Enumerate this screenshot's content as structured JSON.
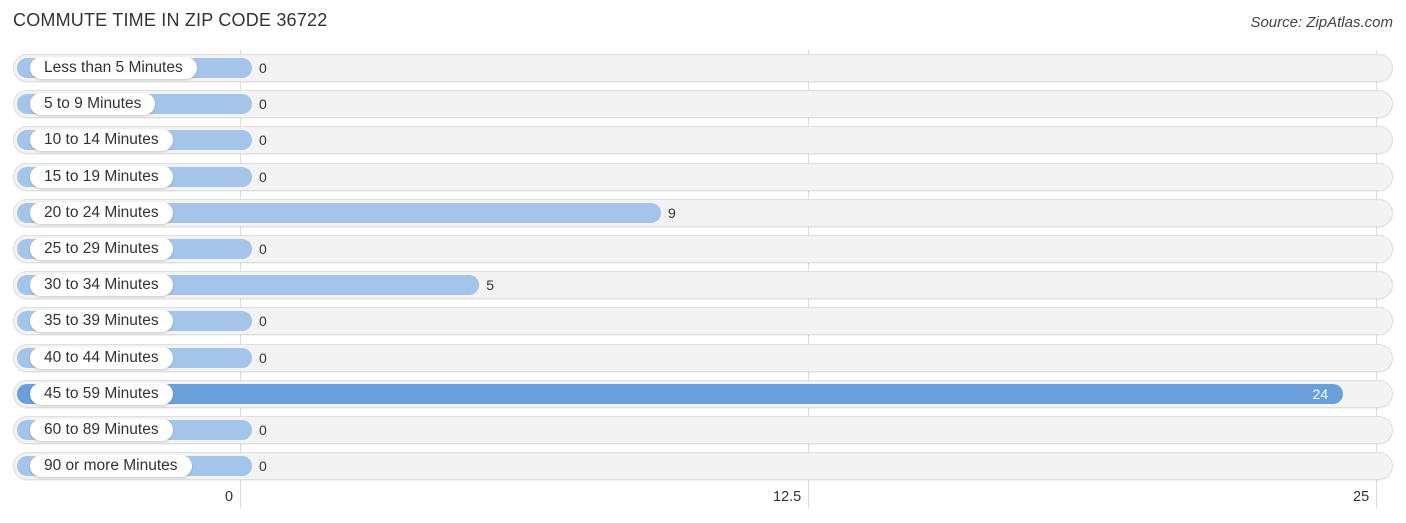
{
  "header": {
    "title": "COMMUTE TIME IN ZIP CODE 36722",
    "source": "Source: ZipAtlas.com"
  },
  "colors": {
    "bar": "#a4c4ea",
    "bar_max": "#6a9fdb",
    "track": "#f3f3f3",
    "grid": "#dcdcdc"
  },
  "chart_data": {
    "type": "bar",
    "orientation": "horizontal",
    "title": "COMMUTE TIME IN ZIP CODE 36722",
    "xlabel": "",
    "ylabel": "",
    "categories": [
      "Less than 5 Minutes",
      "5 to 9 Minutes",
      "10 to 14 Minutes",
      "15 to 19 Minutes",
      "20 to 24 Minutes",
      "25 to 29 Minutes",
      "30 to 34 Minutes",
      "35 to 39 Minutes",
      "40 to 44 Minutes",
      "45 to 59 Minutes",
      "60 to 89 Minutes",
      "90 or more Minutes"
    ],
    "values": [
      0,
      0,
      0,
      0,
      9,
      0,
      5,
      0,
      0,
      24,
      0,
      0
    ],
    "xlim": [
      0,
      25
    ],
    "x_ticks": [
      0,
      12.5,
      25
    ],
    "x_tick_labels": [
      "0",
      "12.5",
      "25"
    ],
    "grid": true,
    "legend": "none"
  }
}
